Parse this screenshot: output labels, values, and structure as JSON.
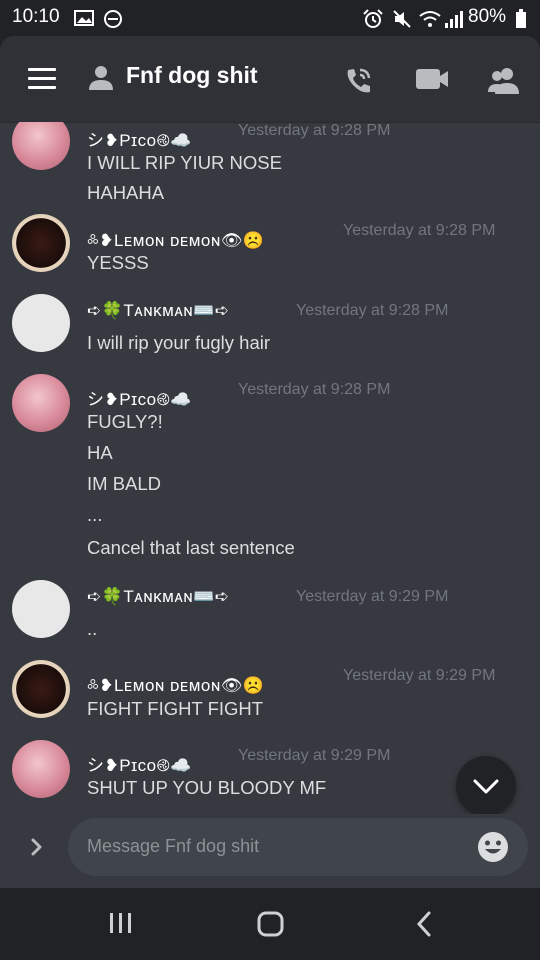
{
  "status_bar": {
    "time": "10:10",
    "battery": "80%"
  },
  "header": {
    "title": "Fnf dog shit"
  },
  "messages": [
    {
      "author": "シ❥Pɪᴄᴏ࿋☁️",
      "timestamp": "Yesterday at 9:28 PM",
      "lines": [
        "I WILL RIP YIUR NOSE",
        "HAHAHA"
      ]
    },
    {
      "author": "༜❥Lᴇᴍᴏɴ ᴅᴇᴍᴏɴ👁☹️",
      "timestamp": "Yesterday at 9:28 PM",
      "lines": [
        "YESSS"
      ]
    },
    {
      "author": "➪🍀Tᴀɴᴋᴍᴀɴ⌨️➪",
      "timestamp": "Yesterday at 9:28 PM",
      "lines": [
        "I will rip your fugly hair"
      ]
    },
    {
      "author": "シ❥Pɪᴄᴏ࿋☁️",
      "timestamp": "Yesterday at 9:28 PM",
      "lines": [
        "FUGLY?!",
        "HA",
        "IM BALD",
        "...",
        "Cancel that last sentence"
      ]
    },
    {
      "author": "➪🍀Tᴀɴᴋᴍᴀɴ⌨️➪",
      "timestamp": "Yesterday at 9:29 PM",
      "lines": [
        ".."
      ]
    },
    {
      "author": "༜❥Lᴇᴍᴏɴ ᴅᴇᴍᴏɴ👁☹️",
      "timestamp": "Yesterday at 9:29 PM",
      "lines": [
        "FIGHT FIGHT FIGHT"
      ]
    },
    {
      "author": "シ❥Pɪᴄᴏ࿋☁️",
      "timestamp": "Yesterday at 9:29 PM",
      "lines": [
        "SHUT UP YOU BLOODY MF"
      ]
    }
  ],
  "composer": {
    "placeholder": "Message Fnf dog shit"
  },
  "icons": {
    "menu": "hamburger-icon",
    "group": "group-dm-icon",
    "call": "phone-call-icon",
    "video": "video-icon",
    "members": "members-icon",
    "expand": "chevron-right-icon",
    "emoji": "emoji-icon",
    "jump": "chevron-down-icon"
  },
  "colors": {
    "background": "#36393f",
    "header": "#2f3136",
    "timestamp": "#72767d",
    "input": "#40444b"
  }
}
